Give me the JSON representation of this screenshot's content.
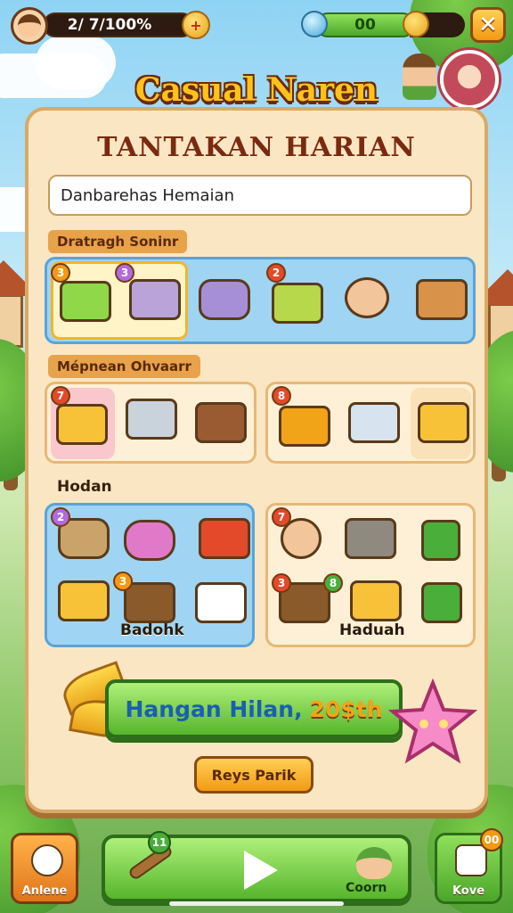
{
  "topbar": {
    "energy_text": "2/ 7/100%",
    "money_text": "00"
  },
  "game_title": "Casual Naren",
  "panel": {
    "title": "TANTAKAN HARIAN",
    "search_value": "Danbarehas Hemaian"
  },
  "sections": {
    "first_label": "Dratragh Soninr",
    "second_label": "Mépnean Ohvaarr",
    "third_label": "Hodan"
  },
  "badges": {
    "row1": [
      "3",
      "3",
      "2"
    ],
    "row2": [
      "7",
      "8"
    ],
    "row3": [
      "2",
      "3",
      "7",
      "3",
      "8"
    ]
  },
  "box_captions": {
    "left": "Badohk",
    "right": "Haduah"
  },
  "reward": {
    "label": "Hangan Hilan,",
    "amount": "20$th"
  },
  "redeem_label": "Reys Parik",
  "bottom": {
    "left_label": "Anlene",
    "center_badge": "11",
    "center_label": "Coorn",
    "right_badge": "00",
    "right_label": "Kove"
  },
  "colors": {
    "accent_orange": "#f29a14",
    "accent_green": "#57b52c",
    "panel_bg": "#fbe6c4",
    "title_brown": "#7a2a10"
  }
}
